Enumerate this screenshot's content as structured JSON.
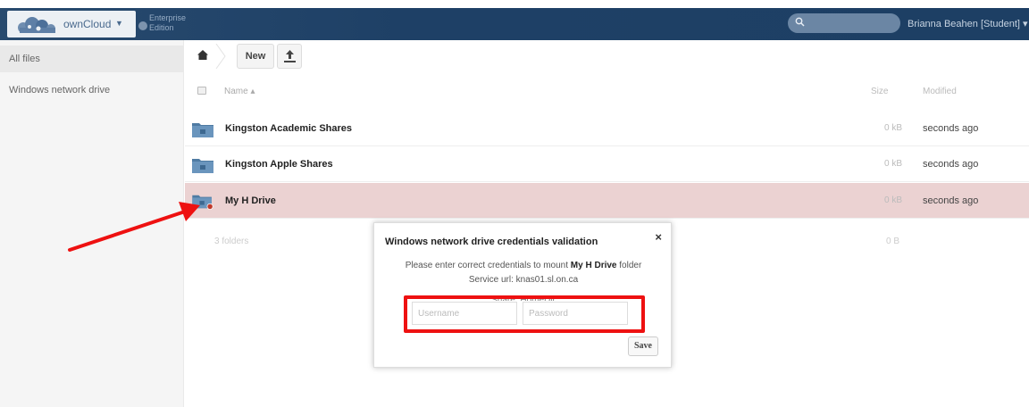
{
  "header": {
    "app_name": "ownCloud",
    "edition_line1": "Enterprise",
    "edition_line2": "Edition",
    "search_placeholder": "",
    "user": "Brianna Beahen [Student] ▾"
  },
  "sidebar": {
    "items": [
      {
        "label": "All files",
        "active": true
      },
      {
        "label": "Windows network drive",
        "active": false
      }
    ]
  },
  "controls": {
    "new_label": "New"
  },
  "list": {
    "columns": {
      "name": "Name ▴",
      "size": "Size",
      "modified": "Modified"
    },
    "rows": [
      {
        "name": "Kingston Academic Shares",
        "size": "0 kB",
        "modified": "seconds ago"
      },
      {
        "name": "Kingston Apple Shares",
        "size": "0 kB",
        "modified": "seconds ago"
      },
      {
        "name": "My H Drive",
        "size": "0 kB",
        "modified": "seconds ago"
      }
    ],
    "summary_folders": "3 folders",
    "summary_size": "0 B"
  },
  "dialog": {
    "title": "Windows network drive credentials validation",
    "close": "×",
    "prompt_prefix": "Please enter correct credentials to mount ",
    "prompt_drive": "My H Drive",
    "prompt_suffix": " folder",
    "service_url": "Service url: knas01.sl.on.ca",
    "share": "Share: HomeDir",
    "username_placeholder": "Username",
    "password_placeholder": "Password",
    "save_label": "Save"
  },
  "colors": {
    "header": "#1d3f64",
    "highlight_row": "#ebd2d2",
    "annotation_red": "#ee1111"
  }
}
